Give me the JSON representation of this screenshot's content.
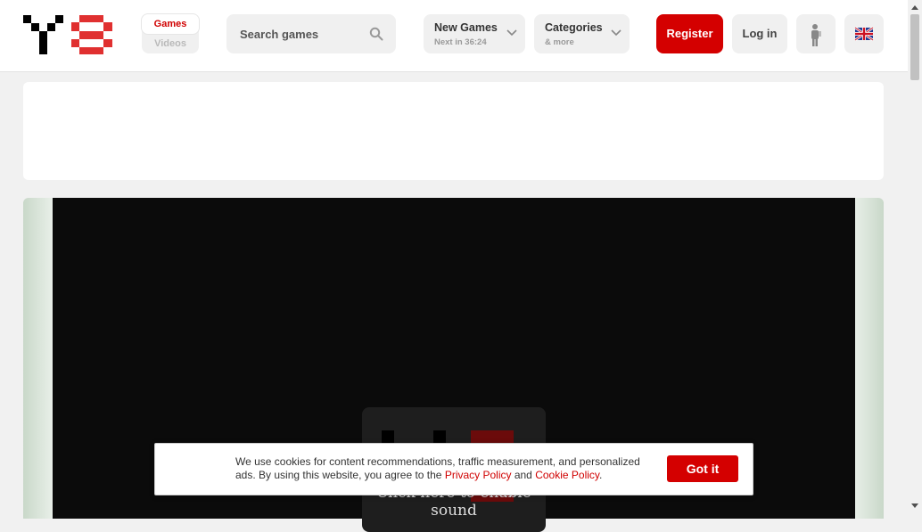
{
  "header": {
    "toggle": {
      "active": "Games",
      "inactive": "Videos"
    },
    "search": {
      "placeholder": "Search games",
      "value": ""
    },
    "new_games": {
      "label": "New Games",
      "sub": "Next in 36:24"
    },
    "categories": {
      "label": "Categories",
      "sub": "& more"
    },
    "register_label": "Register",
    "login_label": "Log in",
    "icons": {
      "search": "search-icon",
      "chevron": "chevron-down-icon",
      "person": "person-icon",
      "flag": "uk-flag-icon",
      "logo": "y8-logo"
    }
  },
  "game": {
    "sound_prompt": "Click here to enable sound"
  },
  "cookie": {
    "text_before": "We use cookies for content recommendations, traffic measurement, and personalized ads. By using this website, you agree to the ",
    "privacy_link": "Privacy Policy",
    "and": " and ",
    "cookie_link": "Cookie Policy",
    "period": ".",
    "button_label": "Got it"
  },
  "colors": {
    "brand_red": "#d40000",
    "header_bg": "#ffffff",
    "page_bg": "#f1f1f1",
    "game_bg": "#0b0b0b"
  }
}
